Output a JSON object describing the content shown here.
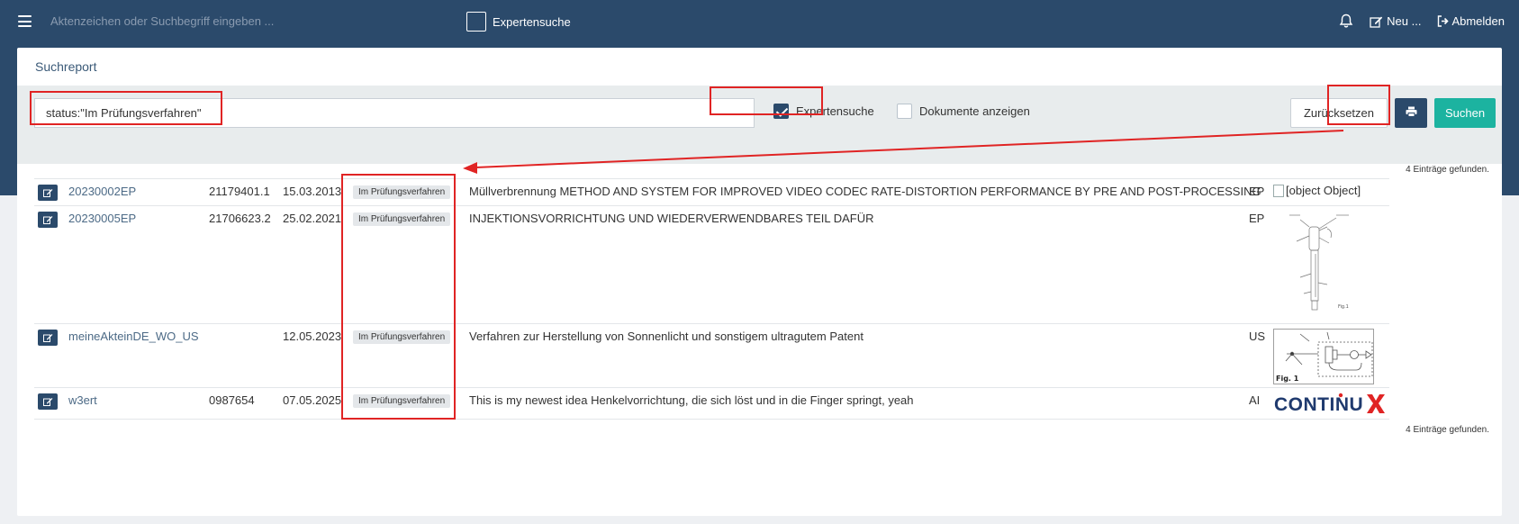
{
  "nav": {
    "search_placeholder": "Aktenzeichen oder Suchbegriff eingeben ...",
    "expert_label": "Expertensuche",
    "new_label": "Neu ...",
    "logout_label": "Abmelden"
  },
  "panel": {
    "title": "Suchreport",
    "query_value": "status:\"Im Prüfungsverfahren\"",
    "expert_label": "Expertensuche",
    "expert_checked": true,
    "documents_label": "Dokumente anzeigen",
    "documents_checked": false,
    "reset_label": "Zurücksetzen",
    "search_label": "Suchen",
    "count_text": "4 Einträge gefunden."
  },
  "results": [
    {
      "name": "20230002EP",
      "number": "21179401.1",
      "date": "15.03.2013",
      "status": "Im Prüfungsverfahren",
      "title": "Müllverbrennung METHOD AND SYSTEM FOR IMPROVED VIDEO CODEC RATE-DISTORTION PERFORMANCE BY PRE AND POST-PROCESSING",
      "country": "EP",
      "image_text": "[object Object]"
    },
    {
      "name": "20230005EP",
      "number": "21706623.2",
      "date": "25.02.2021",
      "status": "Im Prüfungsverfahren",
      "title": "INJEKTIONSVORRICHTUNG UND WIEDERVERWENDBARES TEIL DAFÜR",
      "country": "EP",
      "image": "injector-drawing"
    },
    {
      "name": "meineAkteinDE_WO_US",
      "number": "",
      "date": "12.05.2023",
      "status": "Im Prüfungsverfahren",
      "title": "Verfahren zur Herstellung von Sonnenlicht und sonstigem ultragutem Patent",
      "country": "US",
      "image": "circuit-drawing",
      "image_caption": "Fig. 1"
    },
    {
      "name": "w3ert",
      "number": "0987654",
      "date": "07.05.2025",
      "status": "Im Prüfungsverfahren",
      "title": "This is my newest idea Henkelvorrichtung, die sich löst und in die Finger springt, yeah",
      "country": "AI",
      "image": "logo",
      "logo_text": "CONTINUX"
    }
  ],
  "colors": {
    "navbar": "#2b4a6b",
    "accent": "#1cb3a0",
    "annotation": "#e02424"
  }
}
